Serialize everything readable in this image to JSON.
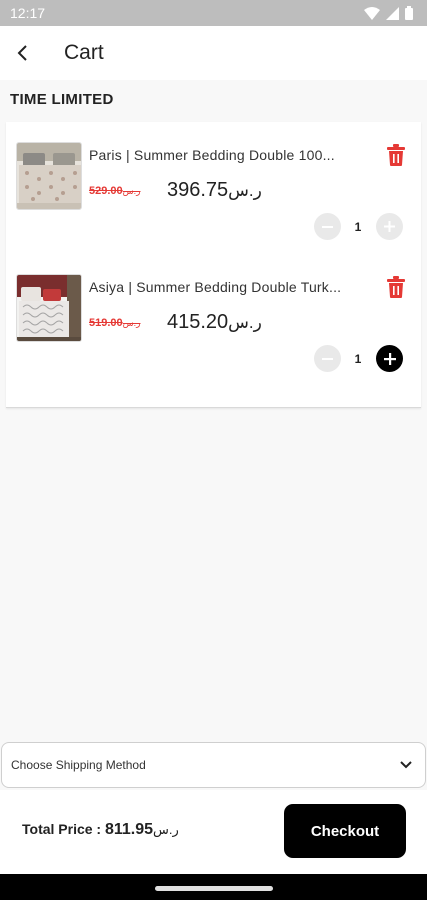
{
  "status_bar": {
    "time": "12:17"
  },
  "app_bar": {
    "title": "Cart"
  },
  "section": {
    "title": "TIME LIMITED"
  },
  "cart_items": [
    {
      "name": "Paris | Summer Bedding Double 100...",
      "old_price": "529.00",
      "new_price": "396.75",
      "currency": "ر.س",
      "quantity": "1",
      "plus_enabled": false
    },
    {
      "name": "Asiya | Summer Bedding Double Turk...",
      "old_price": "519.00",
      "new_price": "415.20",
      "currency": "ر.س",
      "quantity": "1",
      "plus_enabled": true
    }
  ],
  "shipping": {
    "placeholder": "Choose Shipping Method"
  },
  "footer": {
    "total_label": "Total Price : ",
    "total_amount": "811.95",
    "currency": "ر.س",
    "checkout_label": "Checkout"
  },
  "colors": {
    "accent": "#000000",
    "sale_red": "#e53935",
    "delete_red": "#e53935"
  }
}
